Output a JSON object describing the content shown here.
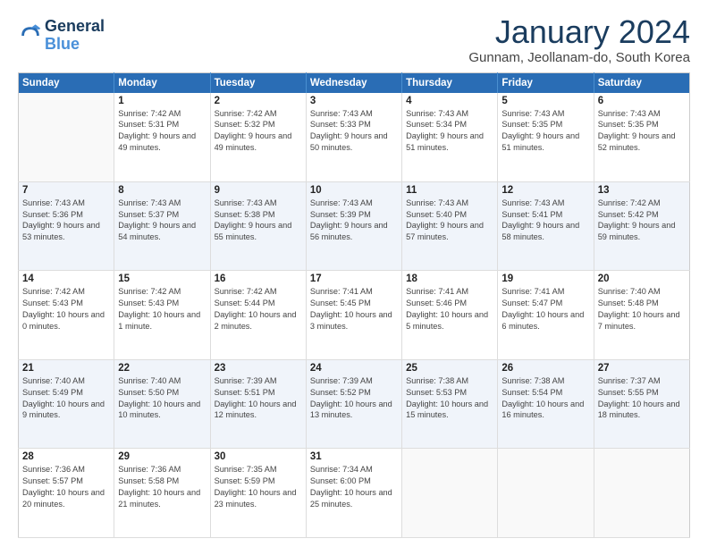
{
  "header": {
    "logo_line1": "General",
    "logo_line2": "Blue",
    "title": "January 2024",
    "subtitle": "Gunnam, Jeollanam-do, South Korea"
  },
  "days_of_week": [
    "Sunday",
    "Monday",
    "Tuesday",
    "Wednesday",
    "Thursday",
    "Friday",
    "Saturday"
  ],
  "weeks": [
    [
      {
        "day": "",
        "sunrise": "",
        "sunset": "",
        "daylight": ""
      },
      {
        "day": "1",
        "sunrise": "Sunrise: 7:42 AM",
        "sunset": "Sunset: 5:31 PM",
        "daylight": "Daylight: 9 hours and 49 minutes."
      },
      {
        "day": "2",
        "sunrise": "Sunrise: 7:42 AM",
        "sunset": "Sunset: 5:32 PM",
        "daylight": "Daylight: 9 hours and 49 minutes."
      },
      {
        "day": "3",
        "sunrise": "Sunrise: 7:43 AM",
        "sunset": "Sunset: 5:33 PM",
        "daylight": "Daylight: 9 hours and 50 minutes."
      },
      {
        "day": "4",
        "sunrise": "Sunrise: 7:43 AM",
        "sunset": "Sunset: 5:34 PM",
        "daylight": "Daylight: 9 hours and 51 minutes."
      },
      {
        "day": "5",
        "sunrise": "Sunrise: 7:43 AM",
        "sunset": "Sunset: 5:35 PM",
        "daylight": "Daylight: 9 hours and 51 minutes."
      },
      {
        "day": "6",
        "sunrise": "Sunrise: 7:43 AM",
        "sunset": "Sunset: 5:35 PM",
        "daylight": "Daylight: 9 hours and 52 minutes."
      }
    ],
    [
      {
        "day": "7",
        "sunrise": "Sunrise: 7:43 AM",
        "sunset": "Sunset: 5:36 PM",
        "daylight": "Daylight: 9 hours and 53 minutes."
      },
      {
        "day": "8",
        "sunrise": "Sunrise: 7:43 AM",
        "sunset": "Sunset: 5:37 PM",
        "daylight": "Daylight: 9 hours and 54 minutes."
      },
      {
        "day": "9",
        "sunrise": "Sunrise: 7:43 AM",
        "sunset": "Sunset: 5:38 PM",
        "daylight": "Daylight: 9 hours and 55 minutes."
      },
      {
        "day": "10",
        "sunrise": "Sunrise: 7:43 AM",
        "sunset": "Sunset: 5:39 PM",
        "daylight": "Daylight: 9 hours and 56 minutes."
      },
      {
        "day": "11",
        "sunrise": "Sunrise: 7:43 AM",
        "sunset": "Sunset: 5:40 PM",
        "daylight": "Daylight: 9 hours and 57 minutes."
      },
      {
        "day": "12",
        "sunrise": "Sunrise: 7:43 AM",
        "sunset": "Sunset: 5:41 PM",
        "daylight": "Daylight: 9 hours and 58 minutes."
      },
      {
        "day": "13",
        "sunrise": "Sunrise: 7:42 AM",
        "sunset": "Sunset: 5:42 PM",
        "daylight": "Daylight: 9 hours and 59 minutes."
      }
    ],
    [
      {
        "day": "14",
        "sunrise": "Sunrise: 7:42 AM",
        "sunset": "Sunset: 5:43 PM",
        "daylight": "Daylight: 10 hours and 0 minutes."
      },
      {
        "day": "15",
        "sunrise": "Sunrise: 7:42 AM",
        "sunset": "Sunset: 5:43 PM",
        "daylight": "Daylight: 10 hours and 1 minute."
      },
      {
        "day": "16",
        "sunrise": "Sunrise: 7:42 AM",
        "sunset": "Sunset: 5:44 PM",
        "daylight": "Daylight: 10 hours and 2 minutes."
      },
      {
        "day": "17",
        "sunrise": "Sunrise: 7:41 AM",
        "sunset": "Sunset: 5:45 PM",
        "daylight": "Daylight: 10 hours and 3 minutes."
      },
      {
        "day": "18",
        "sunrise": "Sunrise: 7:41 AM",
        "sunset": "Sunset: 5:46 PM",
        "daylight": "Daylight: 10 hours and 5 minutes."
      },
      {
        "day": "19",
        "sunrise": "Sunrise: 7:41 AM",
        "sunset": "Sunset: 5:47 PM",
        "daylight": "Daylight: 10 hours and 6 minutes."
      },
      {
        "day": "20",
        "sunrise": "Sunrise: 7:40 AM",
        "sunset": "Sunset: 5:48 PM",
        "daylight": "Daylight: 10 hours and 7 minutes."
      }
    ],
    [
      {
        "day": "21",
        "sunrise": "Sunrise: 7:40 AM",
        "sunset": "Sunset: 5:49 PM",
        "daylight": "Daylight: 10 hours and 9 minutes."
      },
      {
        "day": "22",
        "sunrise": "Sunrise: 7:40 AM",
        "sunset": "Sunset: 5:50 PM",
        "daylight": "Daylight: 10 hours and 10 minutes."
      },
      {
        "day": "23",
        "sunrise": "Sunrise: 7:39 AM",
        "sunset": "Sunset: 5:51 PM",
        "daylight": "Daylight: 10 hours and 12 minutes."
      },
      {
        "day": "24",
        "sunrise": "Sunrise: 7:39 AM",
        "sunset": "Sunset: 5:52 PM",
        "daylight": "Daylight: 10 hours and 13 minutes."
      },
      {
        "day": "25",
        "sunrise": "Sunrise: 7:38 AM",
        "sunset": "Sunset: 5:53 PM",
        "daylight": "Daylight: 10 hours and 15 minutes."
      },
      {
        "day": "26",
        "sunrise": "Sunrise: 7:38 AM",
        "sunset": "Sunset: 5:54 PM",
        "daylight": "Daylight: 10 hours and 16 minutes."
      },
      {
        "day": "27",
        "sunrise": "Sunrise: 7:37 AM",
        "sunset": "Sunset: 5:55 PM",
        "daylight": "Daylight: 10 hours and 18 minutes."
      }
    ],
    [
      {
        "day": "28",
        "sunrise": "Sunrise: 7:36 AM",
        "sunset": "Sunset: 5:57 PM",
        "daylight": "Daylight: 10 hours and 20 minutes."
      },
      {
        "day": "29",
        "sunrise": "Sunrise: 7:36 AM",
        "sunset": "Sunset: 5:58 PM",
        "daylight": "Daylight: 10 hours and 21 minutes."
      },
      {
        "day": "30",
        "sunrise": "Sunrise: 7:35 AM",
        "sunset": "Sunset: 5:59 PM",
        "daylight": "Daylight: 10 hours and 23 minutes."
      },
      {
        "day": "31",
        "sunrise": "Sunrise: 7:34 AM",
        "sunset": "Sunset: 6:00 PM",
        "daylight": "Daylight: 10 hours and 25 minutes."
      },
      {
        "day": "",
        "sunrise": "",
        "sunset": "",
        "daylight": ""
      },
      {
        "day": "",
        "sunrise": "",
        "sunset": "",
        "daylight": ""
      },
      {
        "day": "",
        "sunrise": "",
        "sunset": "",
        "daylight": ""
      }
    ]
  ]
}
